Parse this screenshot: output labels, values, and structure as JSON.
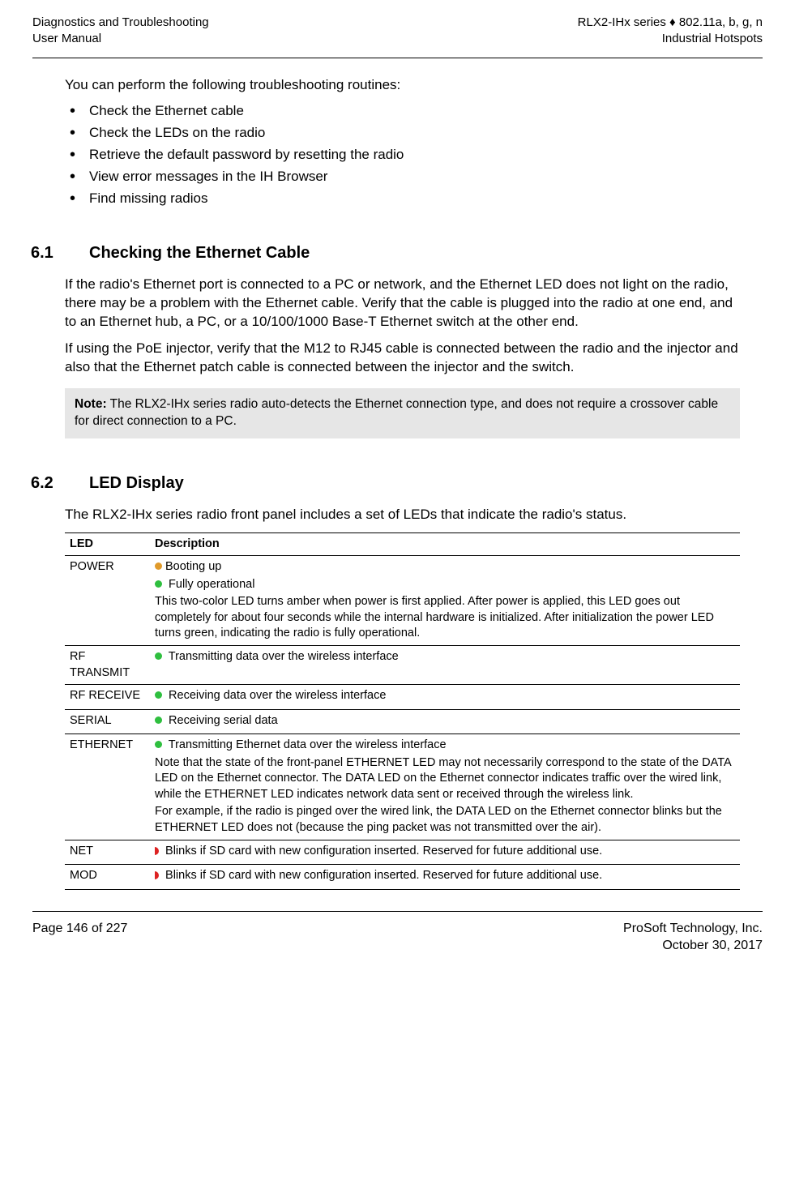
{
  "header": {
    "left_line1": "Diagnostics and Troubleshooting",
    "left_line2": "User Manual",
    "right_line1": "RLX2-IHx series ♦ 802.11a, b, g, n",
    "right_line2": "Industrial Hotspots"
  },
  "intro": "You can perform the following troubleshooting routines:",
  "bullets": [
    "Check the Ethernet cable",
    "Check the LEDs on the radio",
    "Retrieve the default password by resetting the radio",
    "View error messages in the IH Browser",
    "Find missing radios"
  ],
  "section_6_1": {
    "num": "6.1",
    "title": "Checking the Ethernet Cable",
    "para1": "If the radio's Ethernet port is connected to a PC or network, and the Ethernet LED does not light on the radio, there may be a problem with the Ethernet cable. Verify that the cable is plugged into the radio at one end, and to an Ethernet hub, a PC, or a 10/100/1000 Base-T Ethernet switch at the other end.",
    "para2": "If using the PoE injector, verify that the M12 to RJ45 cable is connected between the radio and the injector and also that the Ethernet patch cable is connected between the injector and the switch.",
    "note_label": "Note:",
    "note_text": " The RLX2-IHx series radio auto-detects the Ethernet connection type, and does not require a crossover cable for direct connection to a PC."
  },
  "section_6_2": {
    "num": "6.2",
    "title": "LED Display",
    "para1": "The RLX2-IHx series radio front panel includes a set of LEDs that indicate the radio's status.",
    "table_headers": {
      "led": "LED",
      "desc": "Description"
    },
    "rows": [
      {
        "led": "POWER",
        "lines": [
          {
            "color": "#e09a2b",
            "shape": "dot",
            "text": "Booting up"
          },
          {
            "color": "#2fbf3f",
            "shape": "dot",
            "text": " Fully operational"
          }
        ],
        "paras": [
          "This two-color LED turns amber when power is first applied. After power is applied, this LED goes out completely for about four seconds while the internal hardware is initialized. After initialization the power LED turns green, indicating the radio is fully operational."
        ]
      },
      {
        "led": "RF TRANSMIT",
        "lines": [
          {
            "color": "#2fbf3f",
            "shape": "dot",
            "text": " Transmitting data over the wireless interface"
          }
        ],
        "paras": []
      },
      {
        "led": "RF RECEIVE",
        "lines": [
          {
            "color": "#2fbf3f",
            "shape": "dot",
            "text": " Receiving data over the wireless interface"
          }
        ],
        "paras": []
      },
      {
        "led": "SERIAL",
        "lines": [
          {
            "color": "#2fbf3f",
            "shape": "dot",
            "text": " Receiving serial data"
          }
        ],
        "paras": []
      },
      {
        "led": "ETHERNET",
        "lines": [
          {
            "color": "#2fbf3f",
            "shape": "dot",
            "text": " Transmitting Ethernet data over the wireless interface"
          }
        ],
        "paras": [
          "Note that the state of the front-panel ETHERNET LED may not necessarily correspond to the state of the DATA LED on the Ethernet connector. The DATA LED on the Ethernet connector indicates traffic over the wired link, while the ETHERNET LED indicates network data sent or received through the wireless link.",
          "For example, if the radio is pinged over the wired link, the DATA LED on the Ethernet connector blinks but the ETHERNET LED does not (because the ping packet was not transmitted over the air)."
        ]
      },
      {
        "led": "NET",
        "lines": [
          {
            "color": "#d22",
            "shape": "half",
            "text": " Blinks if SD card with new configuration inserted. Reserved for future additional use."
          }
        ],
        "paras": []
      },
      {
        "led": "MOD",
        "lines": [
          {
            "color": "#d22",
            "shape": "half",
            "text": " Blinks if SD card with new configuration inserted. Reserved for future additional use."
          }
        ],
        "paras": []
      }
    ]
  },
  "footer": {
    "left": "Page 146 of 227",
    "right_line1": "ProSoft Technology, Inc.",
    "right_line2": "October 30, 2017"
  }
}
